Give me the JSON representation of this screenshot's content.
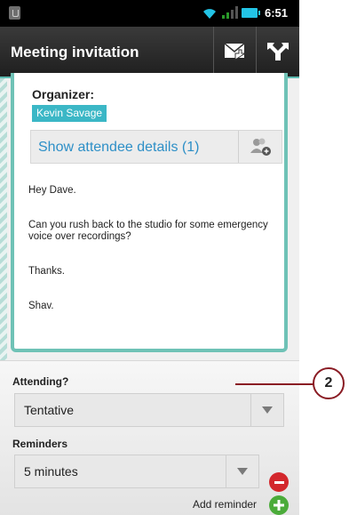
{
  "status_bar": {
    "time": "6:51"
  },
  "header": {
    "title": "Meeting invitation",
    "actions": [
      {
        "icon": "envelope-reply-icon"
      },
      {
        "icon": "reply-all-icon"
      }
    ]
  },
  "invitation": {
    "organizer_label": "Organizer:",
    "organizer_name": "Kevin Savage",
    "attendee_button_label": "Show attendee details (1)",
    "message": [
      "Hey Dave.",
      "Can you rush back to the studio for some emergency voice over recordings?",
      "Thanks.",
      "Shav."
    ]
  },
  "form": {
    "attending_label": "Attending?",
    "attending_value": "Tentative",
    "reminders_label": "Reminders",
    "reminder_value": "5 minutes",
    "add_reminder_label": "Add reminder"
  },
  "callout": {
    "number": "2"
  },
  "colors": {
    "accent": "#6fc2b6",
    "link": "#2d8fc7",
    "chip": "#3bb7c6",
    "remove": "#d3272c",
    "add": "#4bab3a",
    "callout": "#8a1c24"
  }
}
